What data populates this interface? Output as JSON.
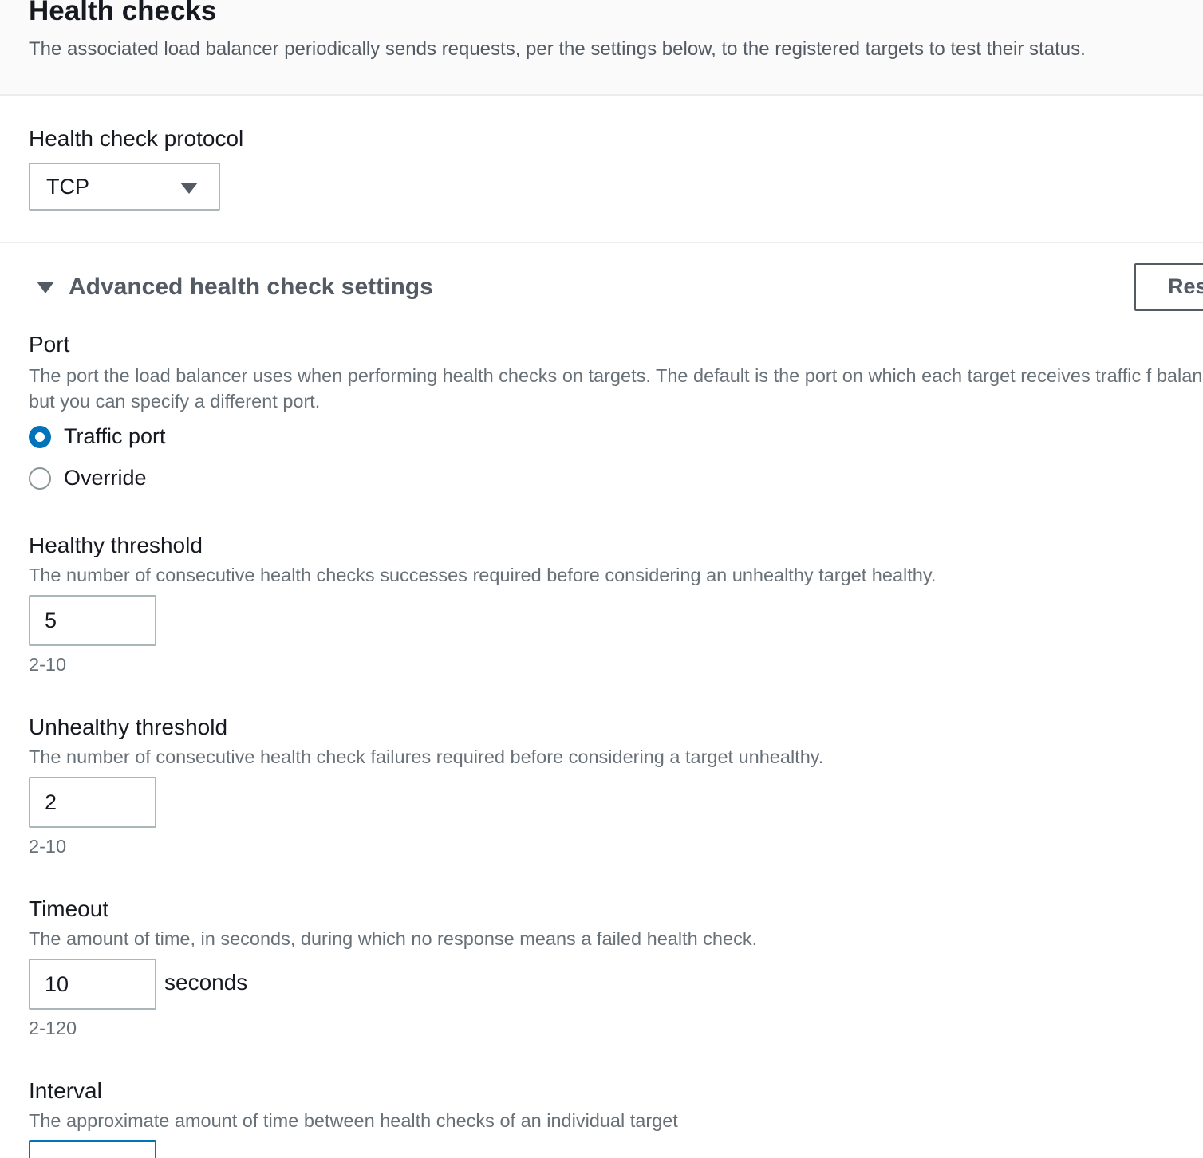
{
  "health_checks": {
    "title": "Health checks",
    "description": "The associated load balancer periodically sends requests, per the settings below, to the registered targets to test their status."
  },
  "protocol": {
    "label": "Health check protocol",
    "selected": "TCP"
  },
  "advanced": {
    "label": "Advanced health check settings",
    "reset_label": "Res",
    "expanded": true
  },
  "port": {
    "label": "Port",
    "description": "The port the load balancer uses when performing health checks on targets. The default is the port on which each target receives traffic f balancer, but you can specify a different port.",
    "options": [
      {
        "label": "Traffic port",
        "checked": true
      },
      {
        "label": "Override",
        "checked": false
      }
    ]
  },
  "healthy_threshold": {
    "label": "Healthy threshold",
    "description": "The number of consecutive health checks successes required before considering an unhealthy target healthy.",
    "value": "5",
    "hint": "2-10"
  },
  "unhealthy_threshold": {
    "label": "Unhealthy threshold",
    "description": "The number of consecutive health check failures required before considering a target unhealthy.",
    "value": "2",
    "hint": "2-10"
  },
  "timeout": {
    "label": "Timeout",
    "description": "The amount of time, in seconds, during which no response means a failed health check.",
    "value": "10",
    "unit": "seconds",
    "hint": "2-120"
  },
  "interval": {
    "label": "Interval",
    "description": "The approximate amount of time between health checks of an individual target"
  },
  "colors": {
    "accent": "#0073bb",
    "text": "#16191f",
    "secondary_text": "#687078",
    "border": "#aab7b8"
  }
}
